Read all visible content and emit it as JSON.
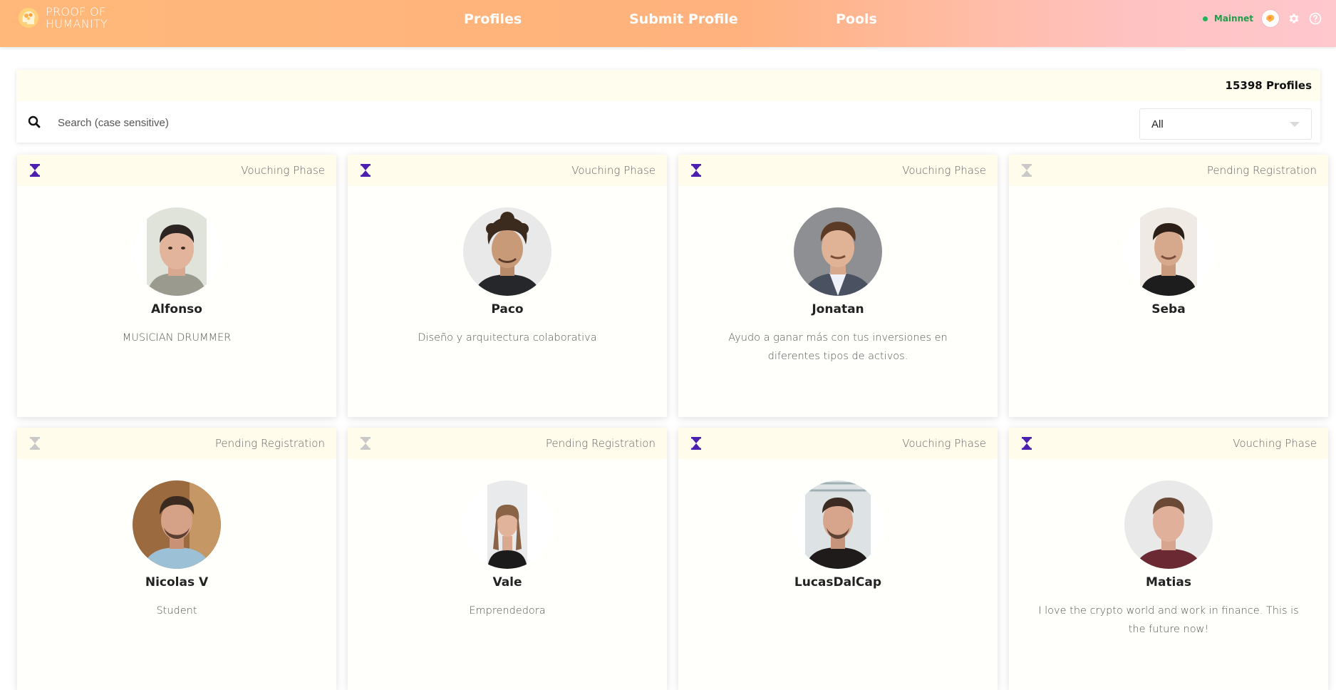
{
  "header": {
    "logo_line1": "PROOF OF",
    "logo_line2": "HUMANITY",
    "nav": [
      "Profiles",
      "Submit Profile",
      "Pools"
    ],
    "network": "Mainnet",
    "network_color": "#1fb35a",
    "icons": [
      "wallet-avatar-icon",
      "gear-icon",
      "help-icon"
    ]
  },
  "search": {
    "profile_count": "15398 Profiles",
    "placeholder": "Search (case sensitive)",
    "filter_value": "All"
  },
  "colors": {
    "vouching_icon": "#4b1fb0",
    "pending_icon": "#c9c9c9"
  },
  "profiles": [
    {
      "status": "Vouching Phase",
      "name": "Alfonso",
      "bio": "MUSICIAN DRUMMER"
    },
    {
      "status": "Vouching Phase",
      "name": "Paco",
      "bio": "Diseño y arquitectura colaborativa"
    },
    {
      "status": "Vouching Phase",
      "name": "Jonatan",
      "bio": "Ayudo a ganar más con tus inversiones en diferentes tipos de activos."
    },
    {
      "status": "Pending Registration",
      "name": "Seba",
      "bio": ""
    },
    {
      "status": "Pending Registration",
      "name": "Nicolas V",
      "bio": "Student"
    },
    {
      "status": "Pending Registration",
      "name": "Vale",
      "bio": "Emprendedora"
    },
    {
      "status": "Vouching Phase",
      "name": "LucasDalCap",
      "bio": ""
    },
    {
      "status": "Vouching Phase",
      "name": "Matias",
      "bio": "I love the crypto world and work in finance. This is the future now!"
    }
  ]
}
